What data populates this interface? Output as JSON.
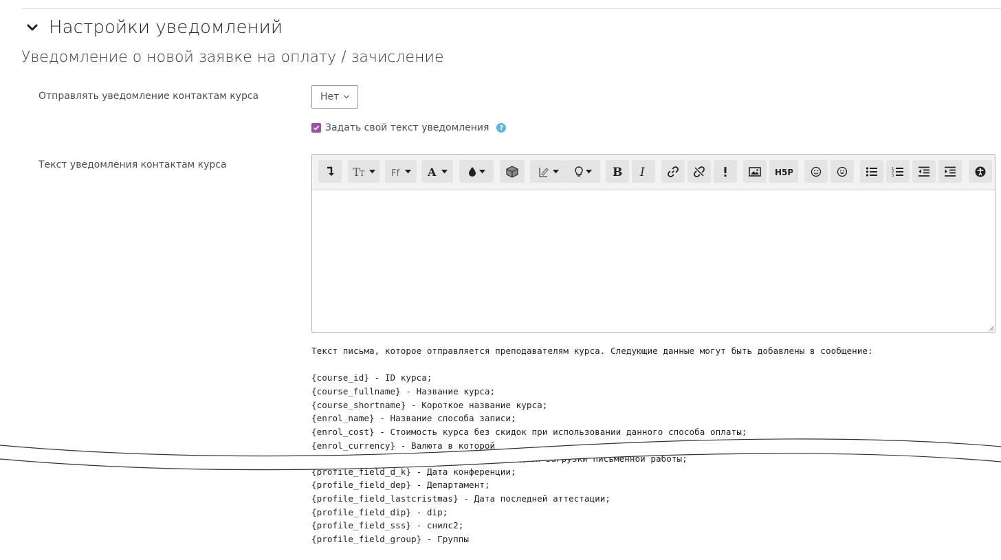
{
  "top_clip_text": "",
  "section": {
    "title": "Настройки уведомлений"
  },
  "subheading": "Уведомление о новой заявке на оплату / зачисление",
  "notify_contacts": {
    "label": "Отправлять уведомление контактам курса",
    "value": "Нет"
  },
  "custom_text_checkbox": {
    "label": "Задать свой текст уведомления",
    "checked": true,
    "help_icon": "question-circle-icon"
  },
  "editor": {
    "label": "Текст уведомления контактам курса",
    "content": "",
    "toolbar_icons": [
      "collapse-icon",
      "font-size-icon",
      "font-family-icon",
      "font-color-icon",
      "highlight-color-icon",
      "cube-icon",
      "paragraph-styles-icon",
      "lightbulb-icon",
      "bold-icon",
      "italic-icon",
      "link-icon",
      "unlink-icon",
      "exclamation-icon",
      "image-icon",
      "h5p-icon",
      "emoji-icon",
      "emoji-picker-icon",
      "unordered-list-icon",
      "ordered-list-icon",
      "outdent-icon",
      "indent-icon",
      "accessibility-icon"
    ]
  },
  "help": {
    "intro": "Текст письма, которое отправляется преподавателям курса. Следующие данные могут быть добавлены в сообщение:",
    "lines": [
      "{course_id} - ID курса;",
      "{course_fullname} - Название курса;",
      "{course_shortname} - Короткое название курса;",
      "{enrol_name} - Название способа записи;",
      "{enrol_cost} - Стоимость курса без скидок при использовании данного способа оплаты;",
      "{enrol_currency} - Валюта в которой",
      "- Дата последней загрузки письменной работы;",
      "{profile_field_d_k} - Дата конференции;",
      "{profile_field_dep} - Департамент;",
      "{profile_field_lastcristmas} - Дата последней аттестации;",
      "{profile_field_dip} - dip;",
      "{profile_field_sss} - снилс2;",
      "{profile_field_group} - Группы"
    ]
  },
  "colors": {
    "accent": "#9e4ea8",
    "help_icon": "#5bb7e0",
    "toolbar_bg": "#f2f2f2",
    "button_bg": "#e4e4e4"
  }
}
